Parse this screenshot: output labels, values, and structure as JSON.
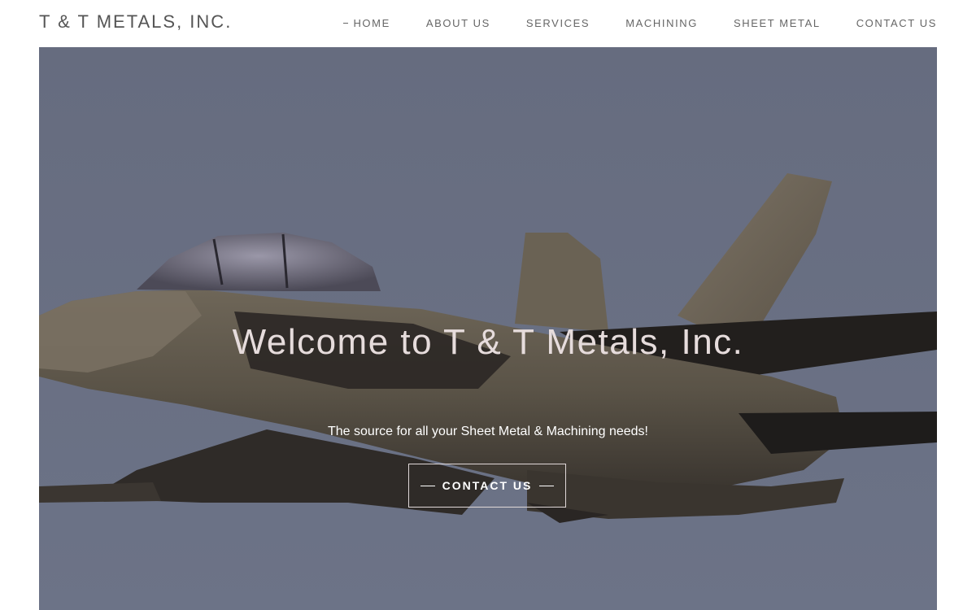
{
  "header": {
    "logo": "T & T METALS, INC.",
    "nav": [
      {
        "label": "HOME",
        "active": true
      },
      {
        "label": "ABOUT US",
        "active": false
      },
      {
        "label": "SERVICES",
        "active": false
      },
      {
        "label": "MACHINING",
        "active": false
      },
      {
        "label": "SHEET METAL",
        "active": false
      },
      {
        "label": "CONTACT US",
        "active": false
      }
    ]
  },
  "hero": {
    "image": "fighter-jet-photo",
    "title": "Welcome to T & T Metals, Inc.",
    "subtitle": "The source for all your Sheet Metal & Machining needs!",
    "cta_label": "CONTACT US"
  },
  "colors": {
    "nav_text": "#666666",
    "logo_text": "#555555",
    "sky": "#666d80",
    "hero_title": "#e6dcdc"
  }
}
